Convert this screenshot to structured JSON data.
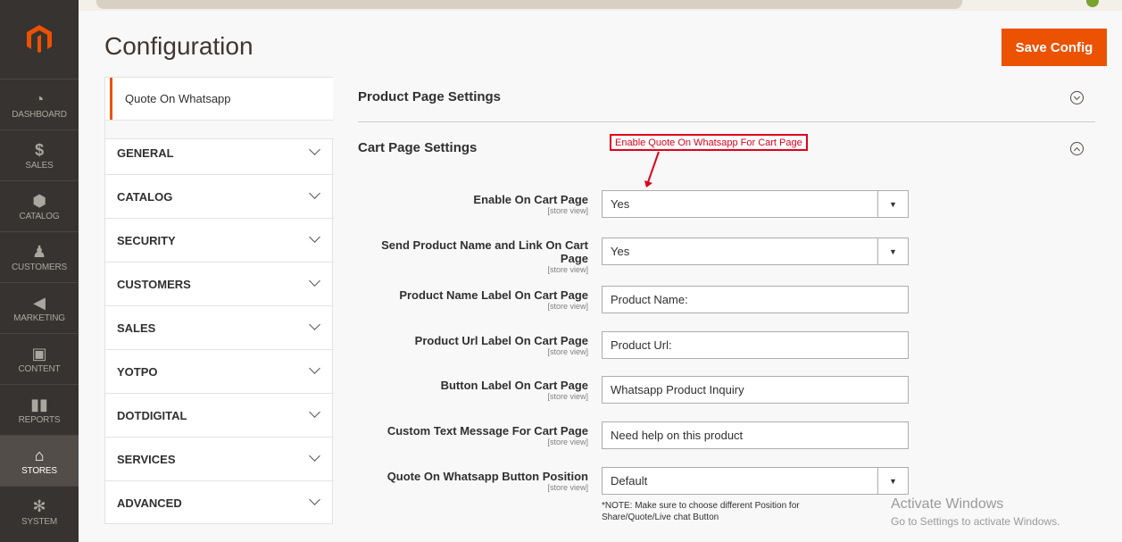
{
  "nav": {
    "items": [
      {
        "label": "DASHBOARD",
        "icon": "dashboard-icon",
        "glyph": "◔"
      },
      {
        "label": "SALES",
        "icon": "dollar-icon",
        "glyph": "$"
      },
      {
        "label": "CATALOG",
        "icon": "cube-icon",
        "glyph": "⬢"
      },
      {
        "label": "CUSTOMERS",
        "icon": "person-icon",
        "glyph": "♟"
      },
      {
        "label": "MARKETING",
        "icon": "megaphone-icon",
        "glyph": "◀"
      },
      {
        "label": "CONTENT",
        "icon": "layout-icon",
        "glyph": "▣"
      },
      {
        "label": "REPORTS",
        "icon": "bar-chart-icon",
        "glyph": "▮▮"
      },
      {
        "label": "STORES",
        "icon": "store-icon",
        "glyph": "⌂"
      },
      {
        "label": "SYSTEM",
        "icon": "gear-icon",
        "glyph": "✻"
      }
    ]
  },
  "header": {
    "title": "Configuration",
    "save_label": "Save Config"
  },
  "tabs": {
    "current": "Quote On Whatsapp",
    "items": [
      "GENERAL",
      "CATALOG",
      "SECURITY",
      "CUSTOMERS",
      "SALES",
      "YOTPO",
      "DOTDIGITAL",
      "SERVICES",
      "ADVANCED"
    ]
  },
  "sections": {
    "product_page": "Product Page Settings",
    "cart_page": "Cart Page Settings"
  },
  "annotation": "Enable Quote On Whatsapp For Cart Page",
  "form": {
    "scope": "[store view]",
    "rows": [
      {
        "label": "Enable On Cart Page",
        "value": "Yes"
      },
      {
        "label": "Send Product Name and Link On Cart Page",
        "value": "Yes"
      },
      {
        "label": "Product Name Label On Cart Page",
        "value": "Product Name:"
      },
      {
        "label": "Product Url Label On Cart Page",
        "value": "Product Url:"
      },
      {
        "label": "Button Label On Cart Page",
        "value": "Whatsapp Product Inquiry"
      },
      {
        "label": "Custom Text Message For Cart Page",
        "value": "Need help on this product"
      },
      {
        "label": "Quote On Whatsapp Button Position",
        "value": "Default"
      }
    ],
    "note": "*NOTE: Make sure to choose different Position for Share/Quote/Live chat Button"
  },
  "watermark": {
    "line1": "Activate Windows",
    "line2": "Go to Settings to activate Windows."
  },
  "colors": {
    "accent": "#eb5202",
    "nav_bg": "#373330",
    "annotation": "#e0001a"
  }
}
